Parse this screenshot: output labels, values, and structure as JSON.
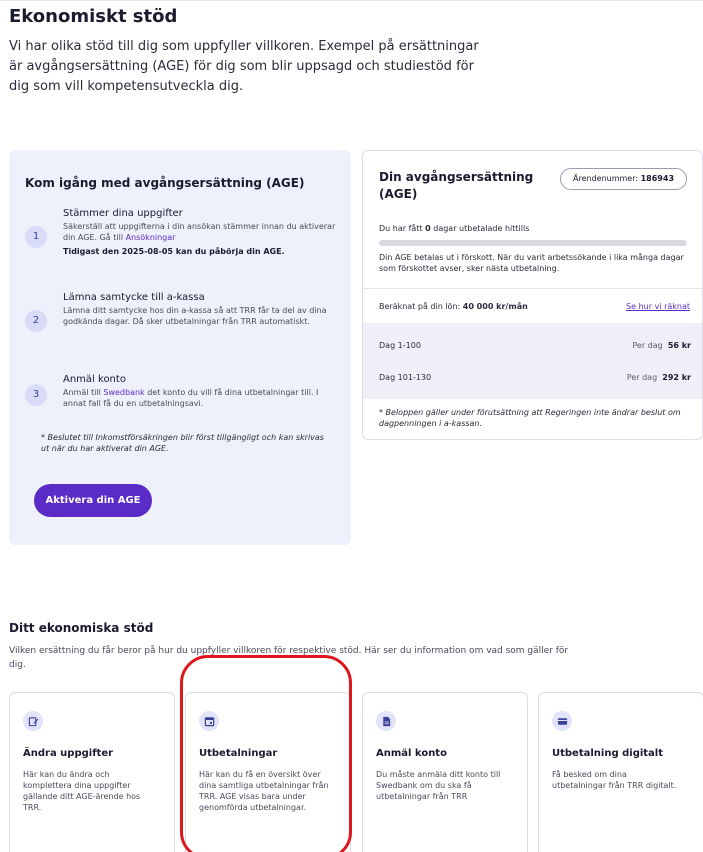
{
  "page": {
    "title": "Ekonomiskt stöd",
    "intro": "Vi har olika stöd till dig som uppfyller villkoren. Exempel på ersättningar är avgångsersättning (AGE) för dig som blir uppsagd och studiestöd för dig som vill kompetensutveckla dig."
  },
  "getting_started": {
    "title": "Kom igång med avgångsersättning (AGE)",
    "steps": [
      {
        "number": "1",
        "title": "Stämmer dina uppgifter",
        "desc_before": "Säkerställ att uppgifterna i din ansökan stämmer innan du aktiverar din AGE. Gå till ",
        "link": "Ansökningar",
        "desc_after": "",
        "strong": "Tidigast den 2025-08-05 kan du påbörja din AGE."
      },
      {
        "number": "2",
        "title": "Lämna samtycke till a-kassa",
        "desc": "Lämna ditt samtycke hos din a-kassa så att TRR får ta del av dina godkända dagar. Då sker utbetalningar från TRR automatiskt."
      },
      {
        "number": "3",
        "title": "Anmäl konto",
        "desc_before": "Anmäl till ",
        "link": "Swedbank",
        "desc_after": " det konto du vill få dina utbetalningar till. I annat fall få du en utbetalningsavi."
      }
    ],
    "footnote": "* Beslutet till Inkomstförsäkringen blir först tillgängligt och kan skrivas ut när du har aktiverat din AGE.",
    "button_label": "Aktivera din AGE"
  },
  "severance": {
    "title": "Din avgångsersättning (AGE)",
    "case_label": "Ärendenummer:",
    "case_number": "186943",
    "paid_before": "Du har fått ",
    "paid_days": "0",
    "paid_after": " dagar utbetalade hittills",
    "progress_fraction": 0,
    "advance_text": "Din AGE betalas ut i förskott. När du varit arbetssökande i lika många dagar som förskottet avser, sker nästa utbetalning.",
    "salary_label": "Beräknat på din lön:",
    "salary_value": "40 000 kr/mån",
    "salary_link": "Se hur vi räknat",
    "rates": [
      {
        "label": "Dag 1-100",
        "per_day_label": "Per dag",
        "amount": "56 kr"
      },
      {
        "label": "Dag 101-130",
        "per_day_label": "Per dag",
        "amount": "292 kr"
      }
    ],
    "footnote": "* Beloppen gäller under förutsättning att Regeringen inte ändrar beslut om dagpenningen i a-kassan."
  },
  "financial_support": {
    "title": "Ditt ekonomiska stöd",
    "desc": "Vilken ersättning du får beror på hur du uppfyller villkoren för respektive stöd. Här ser du information om vad som gäller för dig.",
    "tiles": [
      {
        "icon": "edit-document-icon",
        "title": "Ändra uppgifter",
        "desc": "Här kan du ändra och komplettera dina uppgifter gällande ditt AGE-ärende hos TRR."
      },
      {
        "icon": "calendar-icon",
        "title": "Utbetalningar",
        "desc": "Här kan du få en översikt över dina samtliga utbetalningar från TRR. AGE visas bara under genomförda utbetalningar."
      },
      {
        "icon": "document-icon",
        "title": "Anmäl konto",
        "desc": "Du måste anmäla ditt konto till Swedbank om du ska få utbetalningar från TRR"
      },
      {
        "icon": "card-icon",
        "title": "Utbetalning digitalt",
        "desc": "Få besked om dina utbetalningar från TRR digitalt."
      }
    ]
  },
  "colors": {
    "accent": "#5b2bc8",
    "card_bg": "#eef0fb",
    "highlight": "#e0161f"
  }
}
